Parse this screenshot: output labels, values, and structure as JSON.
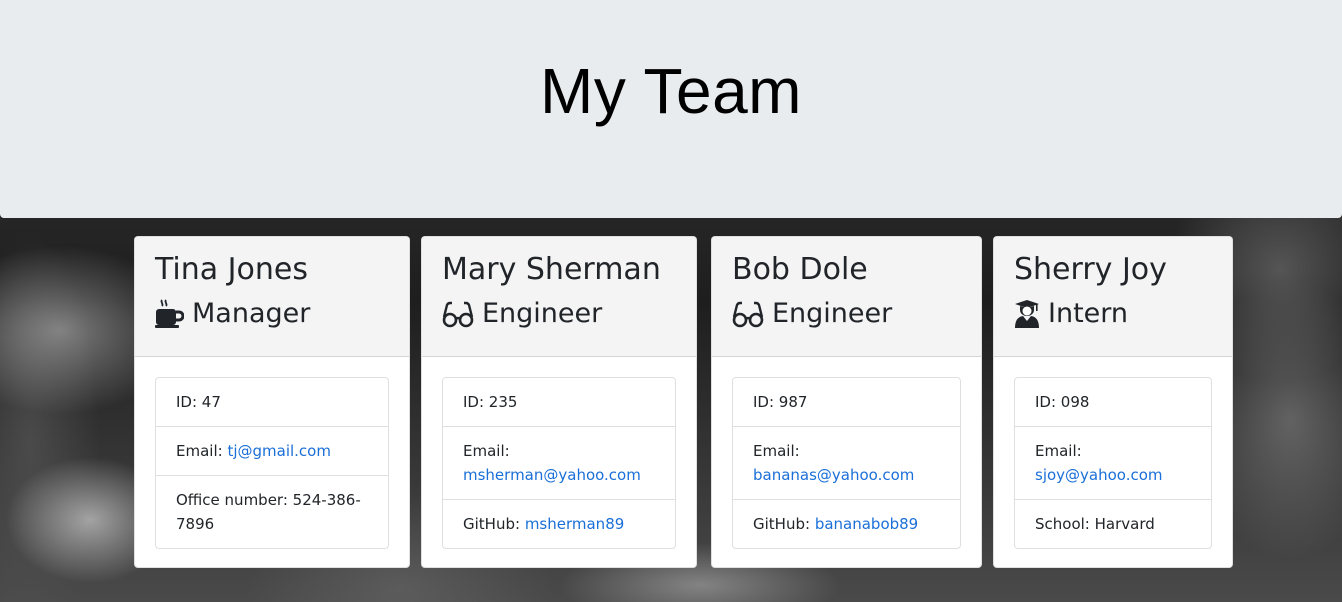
{
  "header": {
    "title": "My Team"
  },
  "cards": [
    {
      "name": "Tina Jones",
      "role": "Manager",
      "role_icon": "coffee-icon",
      "id_label": "ID: ",
      "id": "47",
      "email_label": "Email: ",
      "email": "tj@gmail.com",
      "extra_label": "Office number: ",
      "extra_value": "524-386-7896"
    },
    {
      "name": "Mary Sherman",
      "role": "Engineer",
      "role_icon": "glasses-icon",
      "id_label": "ID: ",
      "id": "235",
      "email_label": "Email: ",
      "email": "msherman@yahoo.com",
      "extra_label": "GitHub: ",
      "extra_value": "msherman89"
    },
    {
      "name": "Bob Dole",
      "role": "Engineer",
      "role_icon": "glasses-icon",
      "id_label": "ID: ",
      "id": "987",
      "email_label": "Email: ",
      "email": "bananas@yahoo.com",
      "extra_label": "GitHub: ",
      "extra_value": "bananabob89"
    },
    {
      "name": "Sherry Joy",
      "role": "Intern",
      "role_icon": "graduate-icon",
      "id_label": "ID: ",
      "id": "098",
      "email_label": "Email: ",
      "email": "sjoy@yahoo.com",
      "extra_label": "School: ",
      "extra_value": "Harvard"
    }
  ],
  "colors": {
    "header_bg": "#e9ecef",
    "link": "#1a6fd8",
    "card_header_bg": "#f4f4f4"
  }
}
